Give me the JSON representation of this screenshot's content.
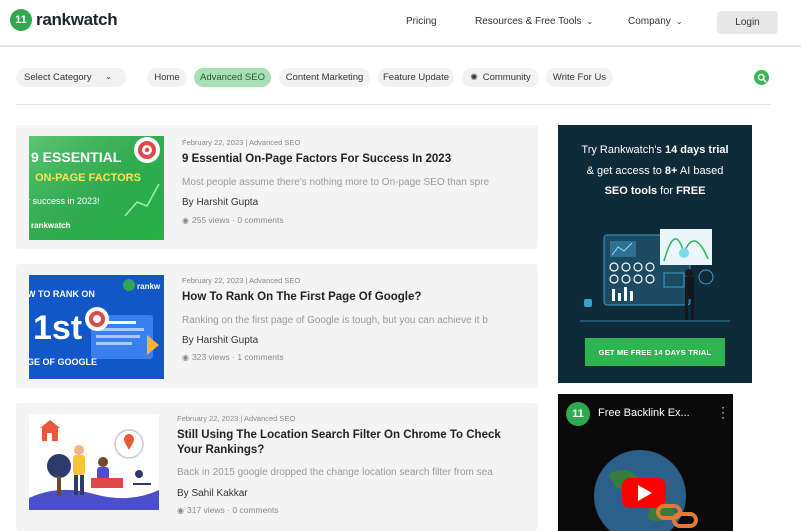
{
  "brand": {
    "name": "rankwatch",
    "mark": "11",
    "color": "#2fa84f"
  },
  "nav": {
    "items": [
      {
        "label": "Pricing",
        "caret": false
      },
      {
        "label": "Resources & Free Tools",
        "caret": true
      },
      {
        "label": "Company",
        "caret": true
      }
    ],
    "login": "Login"
  },
  "categories": {
    "select": "Select Category",
    "pills": [
      "Home",
      "Advanced SEO",
      "Content Marketing",
      "Feature Update",
      "Community",
      "Write For Us"
    ],
    "active": "Advanced SEO",
    "accent": "#a8e0b4"
  },
  "articles": [
    {
      "meta": "February 22, 2023 | Advanced SEO",
      "title": "9 Essential On-Page Factors For Success In 2023",
      "excerpt": "Most people assume there's nothing more to On-page SEO than spre",
      "author": "By Harshit Gupta",
      "stats": "255 views · 0 comments",
      "thumb": {
        "line1": "9 ESSENTIAL",
        "line2": "ON-PAGE FACTORS",
        "line3": "r success in 2023!",
        "brand": "rankwatch"
      }
    },
    {
      "meta": "February 22, 2023 | Advanced SEO",
      "title": "How To Rank On The First Page Of Google?",
      "excerpt": "Ranking on the first page of Google is tough, but you can achieve it b",
      "author": "By Harshit Gupta",
      "stats": "323 views · 1 comments",
      "thumb": {
        "line1": "W TO RANK ON",
        "line2": "1st",
        "line3": "GE OF GOOGLE",
        "brand": "rankw"
      }
    },
    {
      "meta": "February 22, 2023 | Advanced SEO",
      "title": "Still Using The Location Search Filter On Chrome To Check Your Rankings?",
      "excerpt": "Back in 2015 google dropped the change location search filter from sea",
      "author": "By Sahil Kakkar",
      "stats": "317 views · 0 comments"
    }
  ],
  "ad": {
    "line1_pre": "Try Rankwatch's ",
    "line1_bold": "14 days trial",
    "line2_pre": "& get access to ",
    "line2_bold": "8+",
    "line2_post": " AI based",
    "line3_bold": "SEO tools",
    "line3_post": " for ",
    "line3_bold2": "FREE",
    "cta": "GET ME FREE 14 DAYS TRIAL"
  },
  "video": {
    "title": "Free Backlink Ex..."
  }
}
